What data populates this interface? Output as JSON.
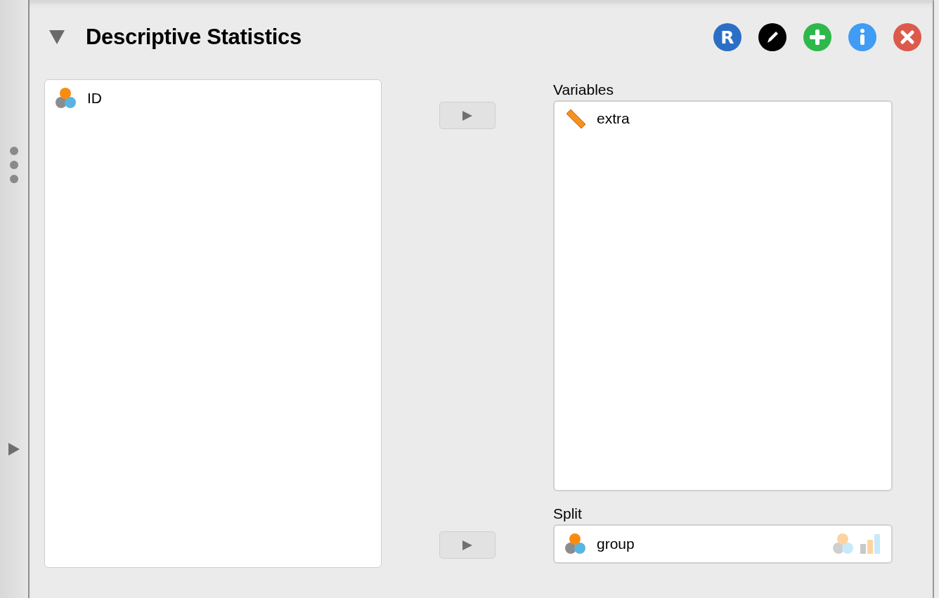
{
  "panel": {
    "title": "Descriptive Statistics",
    "expanded": true
  },
  "header_buttons": [
    {
      "kind": "r",
      "label": "R"
    },
    {
      "kind": "edit"
    },
    {
      "kind": "add"
    },
    {
      "kind": "info"
    },
    {
      "kind": "close"
    }
  ],
  "source_variables": [
    {
      "name": "ID",
      "kind": "nominal"
    }
  ],
  "variables": {
    "label": "Variables",
    "items": [
      {
        "name": "extra",
        "kind": "scale"
      }
    ]
  },
  "split": {
    "label": "Split",
    "items": [
      {
        "name": "group",
        "kind": "nominal"
      }
    ]
  }
}
